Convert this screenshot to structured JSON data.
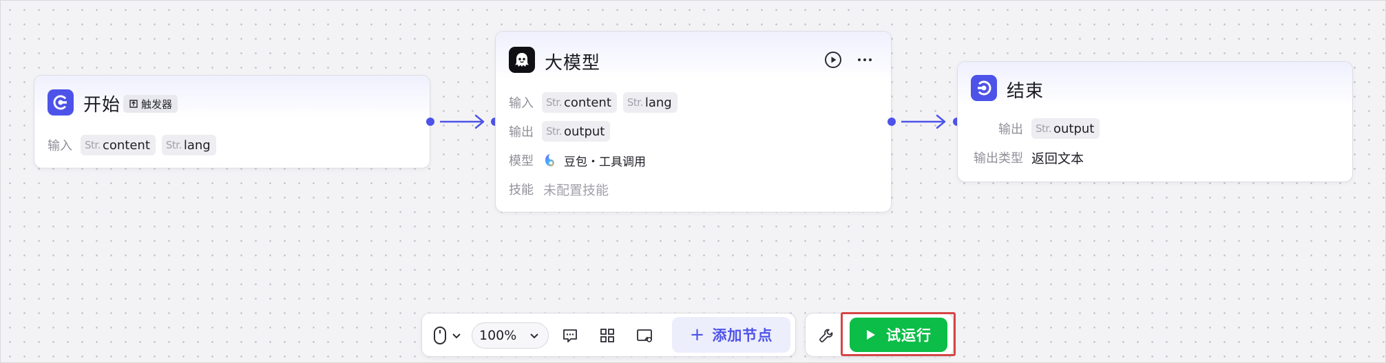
{
  "colors": {
    "accent": "#4d53e8",
    "run_green": "#0cbd47",
    "highlight_red": "#d64545"
  },
  "nodes": {
    "start": {
      "icon": "start-node-icon",
      "title": "开始",
      "badge": "触发器",
      "badge_icon": "trigger-icon",
      "input_label": "输入",
      "inputs": [
        {
          "type": "Str.",
          "name": "content"
        },
        {
          "type": "Str.",
          "name": "lang"
        }
      ]
    },
    "llm": {
      "icon": "llm-robot-icon",
      "title": "大模型",
      "run_icon": "play-circle-icon",
      "more_icon": "more-horizontal-icon",
      "input_label": "输入",
      "inputs": [
        {
          "type": "Str.",
          "name": "content"
        },
        {
          "type": "Str.",
          "name": "lang"
        }
      ],
      "output_label": "输出",
      "outputs": [
        {
          "type": "Str.",
          "name": "output"
        }
      ],
      "model_label": "模型",
      "model_icon": "doubao-model-icon",
      "model_value": "豆包・工具调用",
      "skill_label": "技能",
      "skill_value": "未配置技能"
    },
    "end": {
      "icon": "end-node-icon",
      "title": "结束",
      "output_label": "输出",
      "outputs": [
        {
          "type": "Str.",
          "name": "output"
        }
      ],
      "output_type_label": "输出类型",
      "output_type_value": "返回文本"
    }
  },
  "toolbar": {
    "mouse_icon": "mouse-icon",
    "mouse_chevron": "chevron-down-icon",
    "zoom_value": "100%",
    "zoom_chevron": "chevron-down-icon",
    "comment_icon": "comment-icon",
    "layout_icon": "auto-layout-icon",
    "minimap_icon": "minimap-icon",
    "add_node_label": "添加节点",
    "settings_icon": "wrench-icon",
    "run_label": "试运行",
    "run_icon": "play-icon"
  }
}
